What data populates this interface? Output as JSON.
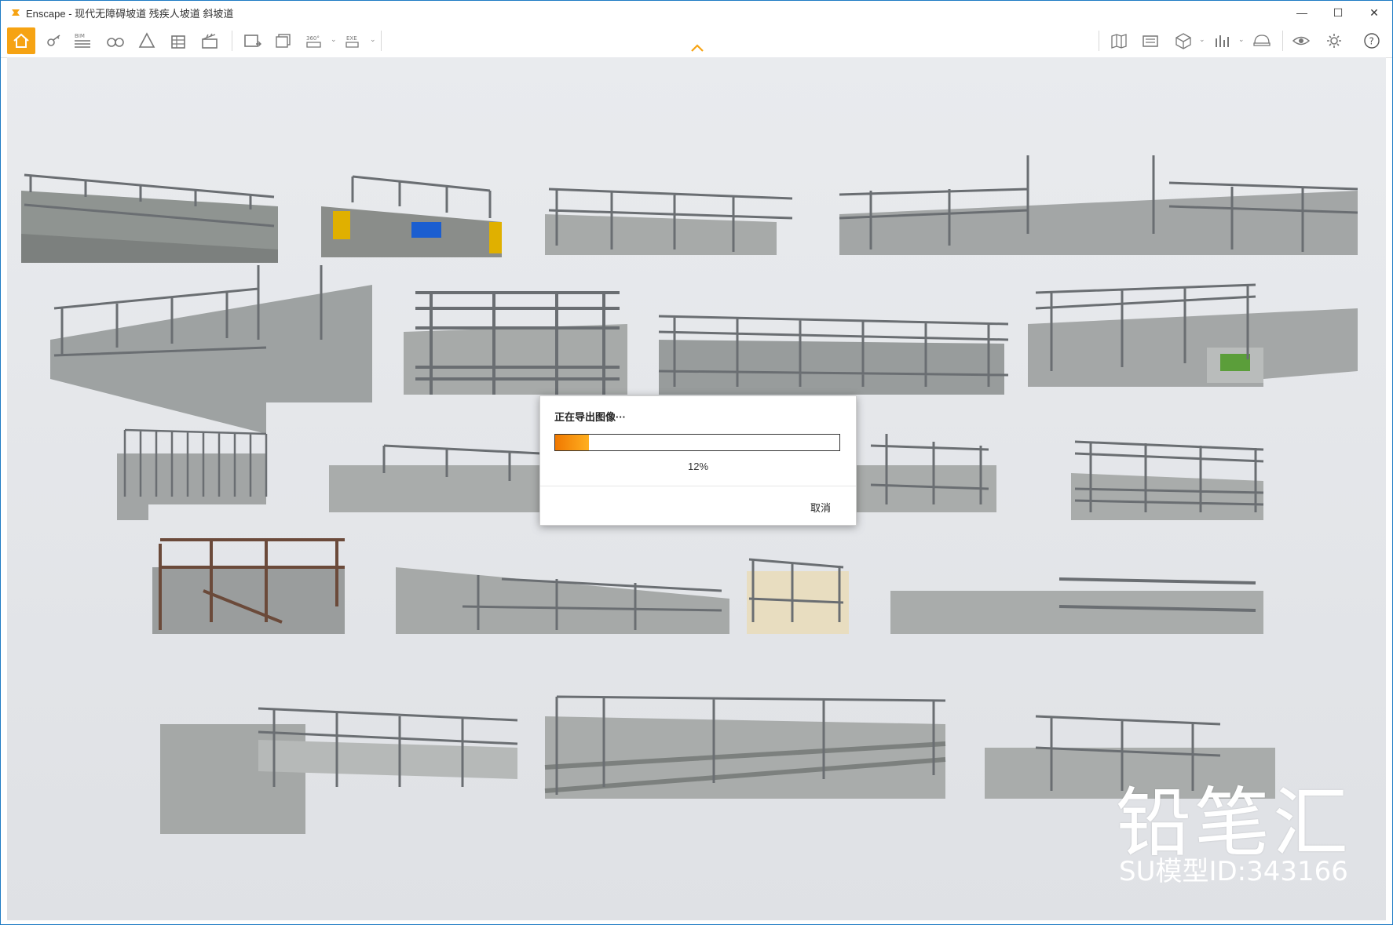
{
  "window": {
    "app_title": "Enscape - 现代无障碍坡道 残疾人坡道 斜坡道",
    "minimize": "—",
    "maximize": "☐",
    "close": "✕"
  },
  "toolbar": {
    "accent_color": "#f6a313",
    "tools": [
      {
        "icon": "home-icon",
        "active": true
      },
      {
        "icon": "key-icon"
      },
      {
        "icon": "bim-icon",
        "label": "BIM"
      },
      {
        "icon": "binoculars-icon"
      },
      {
        "icon": "asset-library-icon"
      },
      {
        "icon": "building-icon"
      },
      {
        "icon": "clapper-icon"
      },
      {
        "icon": "screenshot-icon"
      },
      {
        "icon": "batch-render-icon"
      },
      {
        "icon": "panorama-icon",
        "label": "360°"
      },
      {
        "icon": "export-icon",
        "label": "EXE"
      },
      {
        "icon": "map-icon"
      },
      {
        "icon": "views-icon"
      },
      {
        "icon": "cube-icon"
      },
      {
        "icon": "bar-chart-icon"
      },
      {
        "icon": "helmet-icon"
      },
      {
        "icon": "eye-icon"
      },
      {
        "icon": "gear-icon"
      },
      {
        "icon": "help-icon"
      }
    ]
  },
  "dialog": {
    "title": "正在导出图像···",
    "progress_percent": 12,
    "progress_label": "12%",
    "cancel_label": "取消"
  },
  "watermark": {
    "brand": "铅笔汇",
    "model_id": "SU模型ID:343166"
  }
}
